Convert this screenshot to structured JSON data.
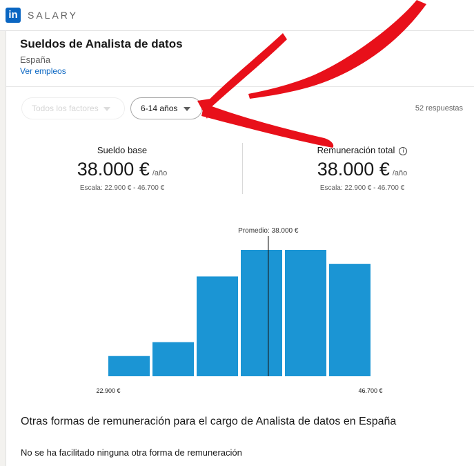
{
  "topbar": {
    "logo_text": "in",
    "brand": "SALARY"
  },
  "header": {
    "title": "Sueldos de Analista de datos",
    "location": "España",
    "view_jobs": "Ver empleos"
  },
  "filters": {
    "factors_label": "Todos los factores",
    "years_label": "6-14 años",
    "responses": "52 respuestas"
  },
  "stats": {
    "base": {
      "label": "Sueldo base",
      "amount": "38.000 €",
      "unit": "/año",
      "range": "Escala: 22.900 € - 46.700 €"
    },
    "total": {
      "label": "Remuneración total",
      "amount": "38.000 €",
      "unit": "/año",
      "range": "Escala: 22.900 € - 46.700 €"
    }
  },
  "chart_data": {
    "type": "bar",
    "bin_count": 6,
    "values": [
      0.16,
      0.27,
      0.79,
      1.0,
      1.0,
      0.89
    ],
    "average_label": "Promedio: 38.000 €",
    "average_position_fraction": 0.61,
    "min_label": "22.900 €",
    "max_label": "46.700 €",
    "bar_color": "#1b95d4"
  },
  "other_compensation": {
    "title": "Otras formas de remuneración para el cargo de Analista de datos en España",
    "note": "No se ha facilitado ninguna otra forma de remuneración"
  },
  "colors": {
    "accent": "#0a66c2",
    "annotation": "#e8101a"
  }
}
